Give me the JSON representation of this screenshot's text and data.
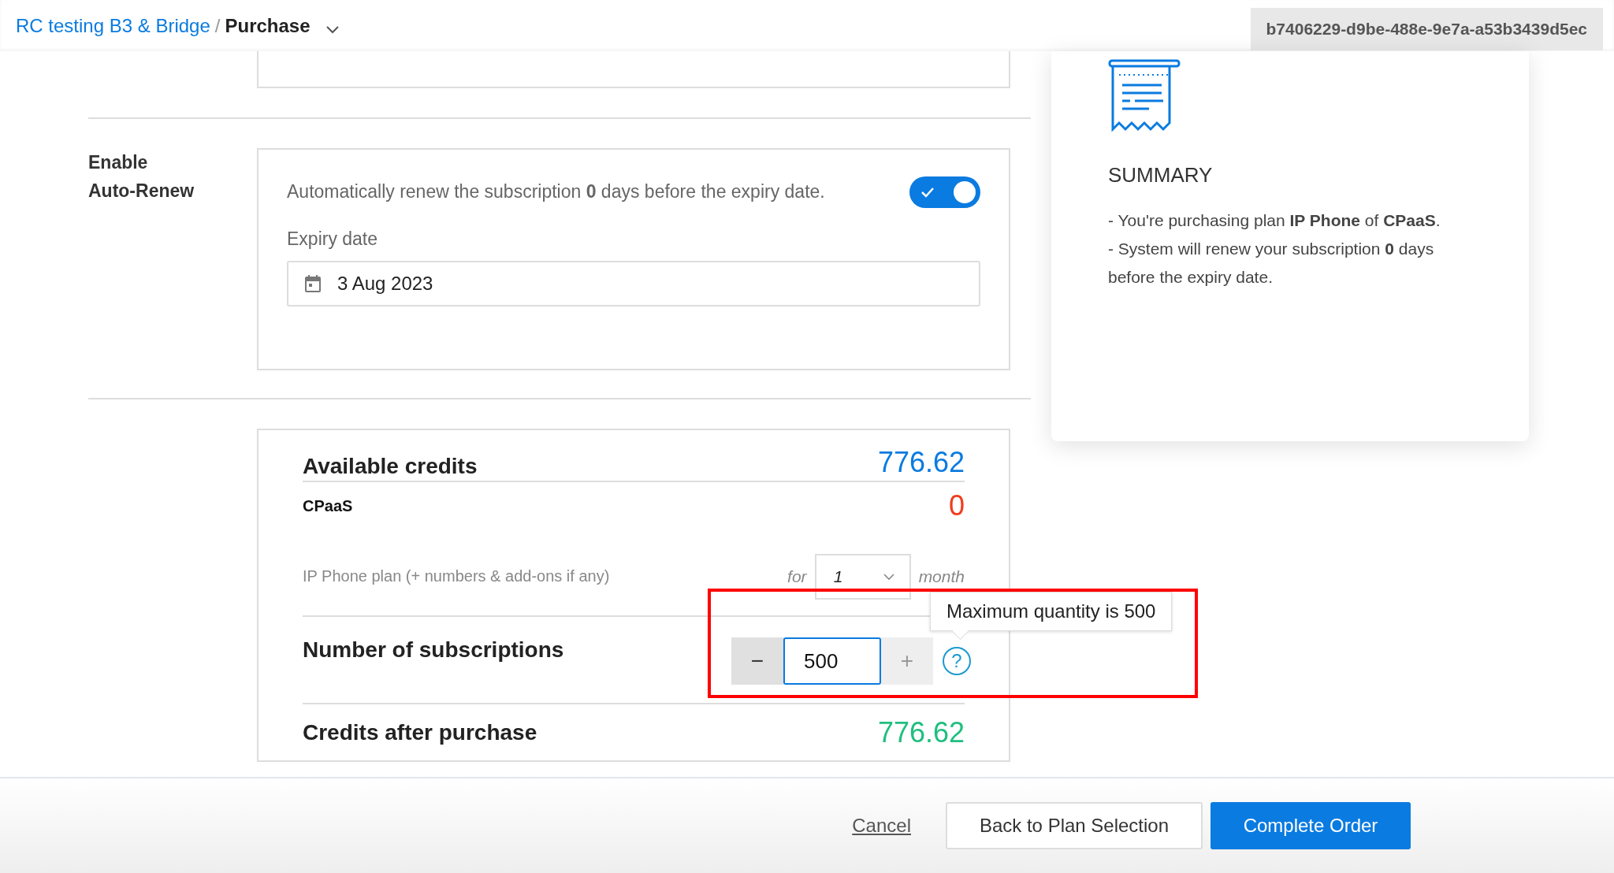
{
  "breadcrumb": {
    "parent": "RC testing B3 & Bridge",
    "separator": "/",
    "current": "Purchase"
  },
  "subscription_id": "b7406229-d9be-488e-9e7a-a53b3439d5ec",
  "auto_renew": {
    "label_lines": [
      "Enable",
      "Auto-Renew"
    ],
    "description": "Automatically renew the subscription **0** days before the expiry date.",
    "on": true,
    "expiry_label": "Expiry date",
    "expiry_value": "3 Aug 2023"
  },
  "credits": {
    "available_label": "Available credits",
    "available_value": "776.62",
    "plan_name": "CPaaS",
    "plan_balance": "0",
    "plan_line": "IP Phone plan (+ numbers & add-ons if any)",
    "for": "for",
    "period_value": "1",
    "period_unit": "month",
    "quantity_label": "Number of subscriptions",
    "minus": "−",
    "quantity_value": "500",
    "plus": "+",
    "help": "?",
    "tooltip": "Maximum quantity is 500",
    "after_label": "Credits after purchase",
    "after_value": "776.62"
  },
  "summary": {
    "title": "SUMMARY",
    "lines": [
      "- You're purchasing plan **IP Phone** of **CPaaS**.",
      "- System will renew your subscription **0** days before the expiry date."
    ]
  },
  "footer": {
    "cancel": "Cancel",
    "back": "Back to Plan Selection",
    "complete": "Complete Order"
  },
  "annotation": {
    "kind": "highlight"
  }
}
